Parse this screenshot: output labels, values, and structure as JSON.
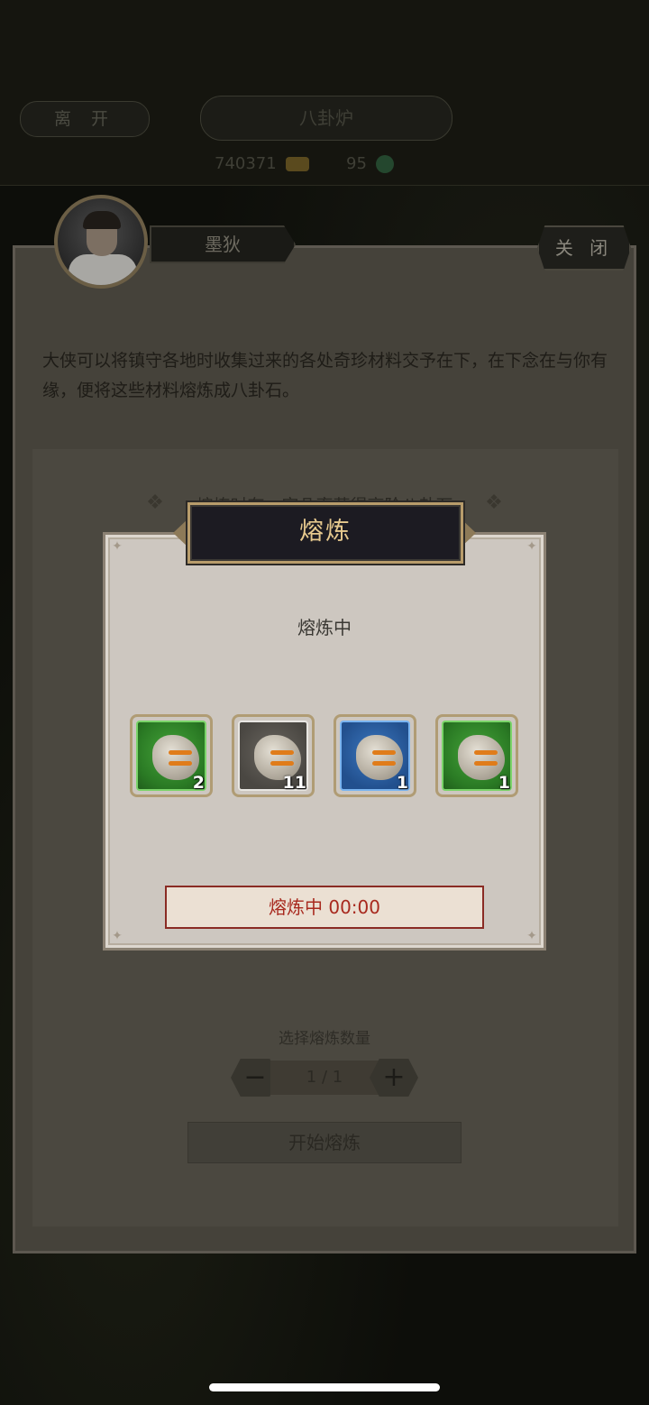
{
  "topbar": {
    "leave_label": "离 开",
    "title": "八卦炉",
    "gold_amount": "740371",
    "jade_amount": "95"
  },
  "npc": {
    "name": "墨狄",
    "close_label": "关 闭",
    "dialog": "大侠可以将镇守各地时收集过来的各处奇珍材料交予在下，在下念在与你有缘，便将这些材料熔炼成八卦石。",
    "hint": "熔炼时有一定几率获得高阶八卦石"
  },
  "smelt_controls": {
    "quantity_label": "选择熔炼数量",
    "quantity_value": "1 / 1",
    "start_label": "开始熔炼"
  },
  "modal": {
    "title": "熔炼",
    "status": "熔炼中",
    "items": [
      {
        "name": "green-bagua-stone",
        "rarity": "green",
        "count": "2"
      },
      {
        "name": "white-bagua-stone",
        "rarity": "white",
        "count": "11"
      },
      {
        "name": "blue-bagua-stone",
        "rarity": "blue",
        "count": "1"
      },
      {
        "name": "green-bagua-stone",
        "rarity": "green",
        "count": "1"
      }
    ],
    "progress_label": "熔炼中 00:00"
  },
  "colors": {
    "title_gold": "#e6c98e",
    "progress_red": "#a8291e",
    "rarity_green": "#46a43a",
    "rarity_blue": "#3c78c0",
    "rarity_white": "#e8e6e2"
  }
}
